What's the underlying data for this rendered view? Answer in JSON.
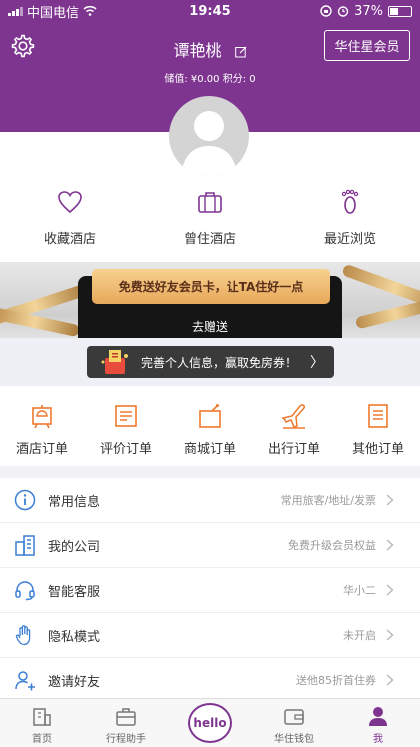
{
  "status_bar": {
    "carrier": "中国电信",
    "time": "19:45",
    "battery": "37%"
  },
  "header": {
    "username": "谭艳桃",
    "member_button": "华住星会员",
    "balance_text": "储值: ¥0.00  积分: 0"
  },
  "quick_links": [
    {
      "label": "收藏酒店",
      "icon": "heart-icon"
    },
    {
      "label": "曾住酒店",
      "icon": "suitcase-icon"
    },
    {
      "label": "最近浏览",
      "icon": "footprint-icon"
    }
  ],
  "banner": {
    "text": "免费送好友会员卡，让TA住好一点",
    "action": "去赠送"
  },
  "promo": {
    "text": "完善个人信息，赢取免房券！",
    "chevron": "〉"
  },
  "orders": [
    {
      "label": "酒店订单",
      "icon": "hotel-bell-icon"
    },
    {
      "label": "评价订单",
      "icon": "review-icon"
    },
    {
      "label": "商城订单",
      "icon": "shop-bag-icon"
    },
    {
      "label": "出行订单",
      "icon": "plane-icon"
    },
    {
      "label": "其他订单",
      "icon": "document-icon"
    }
  ],
  "menu": [
    {
      "label": "常用信息",
      "hint": "常用旅客/地址/发票",
      "icon": "info-icon"
    },
    {
      "label": "我的公司",
      "hint": "免费升级会员权益",
      "icon": "building-icon"
    },
    {
      "label": "智能客服",
      "hint": "华小二",
      "icon": "headset-icon"
    },
    {
      "label": "隐私模式",
      "hint": "未开启",
      "icon": "hand-icon"
    },
    {
      "label": "邀请好友",
      "hint": "送他85折首住券",
      "icon": "add-user-icon"
    }
  ],
  "tab_bar": {
    "tabs": [
      {
        "label": "首页",
        "icon": "home-building-icon"
      },
      {
        "label": "行程助手",
        "icon": "briefcase-icon"
      },
      {
        "label": "",
        "icon": "hello-icon"
      },
      {
        "label": "华住钱包",
        "icon": "wallet-icon"
      },
      {
        "label": "我",
        "icon": "person-icon"
      }
    ],
    "center_logo": "hello"
  },
  "colors": {
    "brand": "#7e3590",
    "accent": "#ef7a2e",
    "text_gray": "#9a9a9a"
  }
}
